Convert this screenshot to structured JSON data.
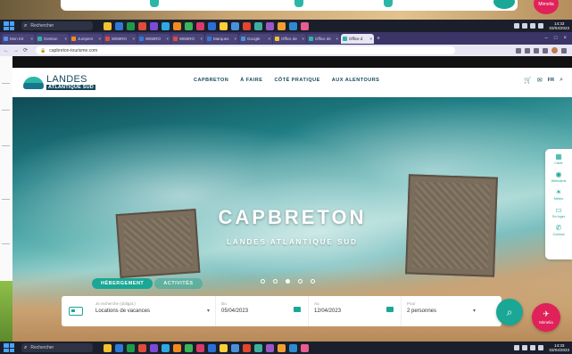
{
  "behind_page": {
    "mimic_label": "Mimelia"
  },
  "taskbar": {
    "search_placeholder": "Rechercher",
    "time": "14:33",
    "date": "03/04/2023",
    "app_colors": [
      "#f2c230",
      "#2f7ad8",
      "#1e9b4a",
      "#e04b3a",
      "#7a4bd6",
      "#2fa8e0",
      "#f28b1f",
      "#3bb55a",
      "#d93b6a",
      "#2a6fd6",
      "#ffcf3a",
      "#4a90d9",
      "#e3452f",
      "#3fb0a0",
      "#9a58c7",
      "#f0a030",
      "#2d8bd1",
      "#e85c8f"
    ]
  },
  "browser": {
    "tabs": [
      {
        "label": "Mon Kit",
        "color": "#5b8def"
      },
      {
        "label": "Gestion",
        "color": "#2bb7a7"
      },
      {
        "label": "Jumpers",
        "color": "#f28b1f"
      },
      {
        "label": "WEBRO",
        "color": "#e04b3a"
      },
      {
        "label": "WEBRO",
        "color": "#2f7ad8"
      },
      {
        "label": "WEBRO",
        "color": "#e04b3a"
      },
      {
        "label": "Marques",
        "color": "#2f7ad8"
      },
      {
        "label": "Google",
        "color": "#4a90d9"
      },
      {
        "label": "Office de",
        "color": "#f2c230"
      },
      {
        "label": "Office de",
        "color": "#2bb7a7"
      },
      {
        "label": "Office d",
        "color": "#2bb7a7",
        "active": true
      }
    ],
    "url": "capbreton-tourisme.com"
  },
  "site": {
    "logo_line1": "LANDES",
    "logo_line2": "ATLANTIQUE SUD",
    "nav": [
      "CAPBRETON",
      "À FAIRE",
      "CÔTÉ PRATIQUE",
      "AUX ALENTOURS"
    ],
    "lang": "FR",
    "hero_title": "CAPBRETON",
    "hero_subtitle": "LANDES ATLANTIQUE SUD",
    "search_tabs": [
      "HÉBERGEMENT",
      "ACTIVITÉS"
    ],
    "search": {
      "type_label": "Je recherche (obligat.)",
      "type_value": "Locations de vacances",
      "arrival_label": "Du",
      "arrival_value": "05/04/2023",
      "departure_label": "Au",
      "departure_value": "12/04/2023",
      "persons_label": "Pour",
      "persons_value": "2 personnes"
    },
    "mimic_label": "Mimelia",
    "side_panel": [
      "Carte",
      "Webcams",
      "Météo",
      "Se loger",
      "Contact"
    ],
    "carousel": {
      "total": 5,
      "active": 3
    }
  }
}
